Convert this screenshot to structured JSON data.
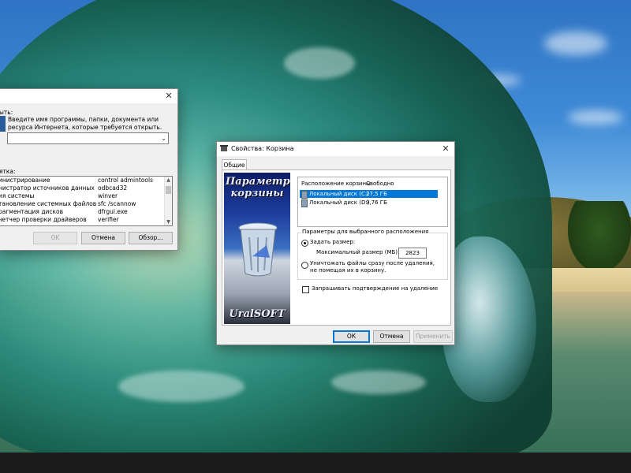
{
  "run_dialog": {
    "title": "",
    "open_label": "ыть:",
    "description": "Введите имя программы, папки, документа или ресурса Интернета, которые требуется открыть.",
    "combo_value": "",
    "history_label": "ятка:",
    "history": [
      {
        "name": "инистрирование",
        "command": "control admintools"
      },
      {
        "name": "нистратор источников данных",
        "command": "odbcad32"
      },
      {
        "name": "ия системы",
        "command": "winver"
      },
      {
        "name": "тановление системных файлов",
        "command": "sfc /scannow"
      },
      {
        "name": "рагментация дисков",
        "command": "dfrgui.exe"
      },
      {
        "name": "четчер проверки драйверов",
        "command": "verifier"
      }
    ],
    "buttons": {
      "ok": "OK",
      "cancel": "Отмена",
      "browse": "Обзор..."
    }
  },
  "properties_dialog": {
    "title": "Свойства: Корзина",
    "tab_general": "Общие",
    "promo": {
      "title": "Параметры корзины",
      "brand": "UralSOFT"
    },
    "locations": {
      "headers": {
        "location": "Расположение корзины",
        "free": "Свободно"
      },
      "rows": [
        {
          "name": "Локальный диск (C:)",
          "free": "27,5 ГБ",
          "selected": true
        },
        {
          "name": "Локальный диск (D:)",
          "free": "9,76 ГБ",
          "selected": false
        }
      ]
    },
    "group_label": "Параметры для выбранного расположения",
    "option_custom": "Задать размер:",
    "max_size_label": "Максимальный размер (МБ):",
    "max_size_value": "2823",
    "option_delete_immediately": "Уничтожать файлы сразу после удаления, не помещая их в корзину.",
    "confirm_delete_label": "Запрашивать подтверждение на удаление",
    "buttons": {
      "ok": "ОК",
      "cancel": "Отмена",
      "apply": "Применить"
    }
  },
  "colors": {
    "accent": "#0078d7",
    "window_bg": "#f0f0f0",
    "taskbar": "#1c1c1c"
  },
  "icons": [
    "close-icon",
    "recycle-bin-icon",
    "run-icon",
    "drive-icon",
    "chevron-down-icon"
  ]
}
